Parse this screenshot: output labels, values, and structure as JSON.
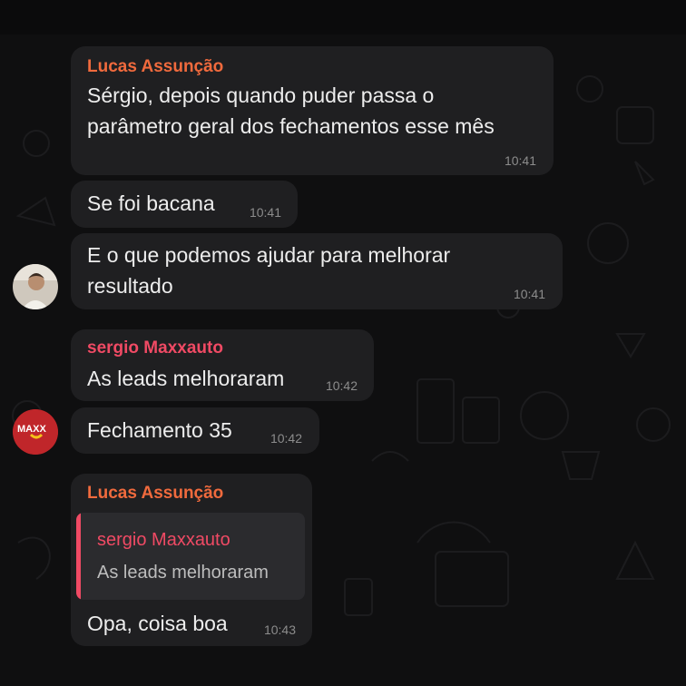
{
  "colors": {
    "background": "#0b0b0c",
    "bubble": "#1f1f21",
    "lucas_name": "#f06a3d",
    "sergio_name": "#f04a64",
    "timestamp": "#8c8c8c",
    "text": "#ededed"
  },
  "messages": [
    {
      "sender": "Lucas Assunção",
      "lines": [
        "Sérgio, depois quando puder passa o",
        "parâmetro geral dos fechamentos esse mês"
      ],
      "time": "10:41"
    },
    {
      "text": "Se foi bacana",
      "time": "10:41"
    },
    {
      "lines": [
        "E o que podemos ajudar para melhorar",
        "resultado"
      ],
      "time": "10:41",
      "avatar": "user-photo-avatar"
    },
    {
      "sender": "sergio Maxxauto",
      "text": "As leads melhoraram",
      "time": "10:42"
    },
    {
      "text": "Fechamento 35",
      "time": "10:42",
      "avatar": "maxx-logo-avatar",
      "avatar_logo_text": "MAXX"
    },
    {
      "sender": "Lucas Assunção",
      "reply": {
        "sender": "sergio Maxxauto",
        "text": "As leads melhoraram"
      },
      "text": "Opa, coisa boa",
      "time": "10:43"
    }
  ]
}
